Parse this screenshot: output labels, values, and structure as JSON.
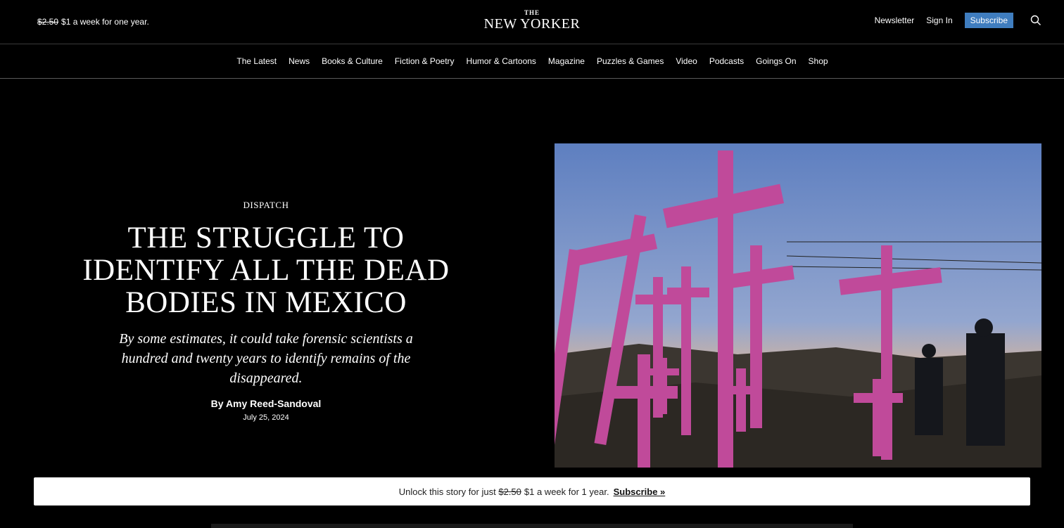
{
  "promo": {
    "old_price": "$2.50",
    "text": "$1 a week for one year."
  },
  "logo": {
    "the": "THE",
    "name": "NEW YORKER"
  },
  "topnav": {
    "newsletter": "Newsletter",
    "sign_in": "Sign In",
    "subscribe": "Subscribe",
    "search_icon": "search-icon"
  },
  "sections": [
    "The Latest",
    "News",
    "Books & Culture",
    "Fiction & Poetry",
    "Humor & Cartoons",
    "Magazine",
    "Puzzles & Games",
    "Video",
    "Podcasts",
    "Goings On",
    "Shop"
  ],
  "article": {
    "rubric": "DISPATCH",
    "headline": "THE STRUGGLE TO IDENTIFY ALL THE DEAD BODIES IN MEXICO",
    "dek": "By some estimates, it could take forensic scientists a hundred and twenty years to identify remains of the disappeared.",
    "byline": "By Amy Reed-Sandoval",
    "date": "July 25, 2024"
  },
  "banner": {
    "prefix": "Unlock this story for just",
    "old_price": "$2.50",
    "text": "$1 a week for 1 year.",
    "cta": "Subscribe »"
  },
  "colors": {
    "background": "#000000",
    "subscribe_button": "#3f7dbf",
    "banner": "#ffffff"
  }
}
